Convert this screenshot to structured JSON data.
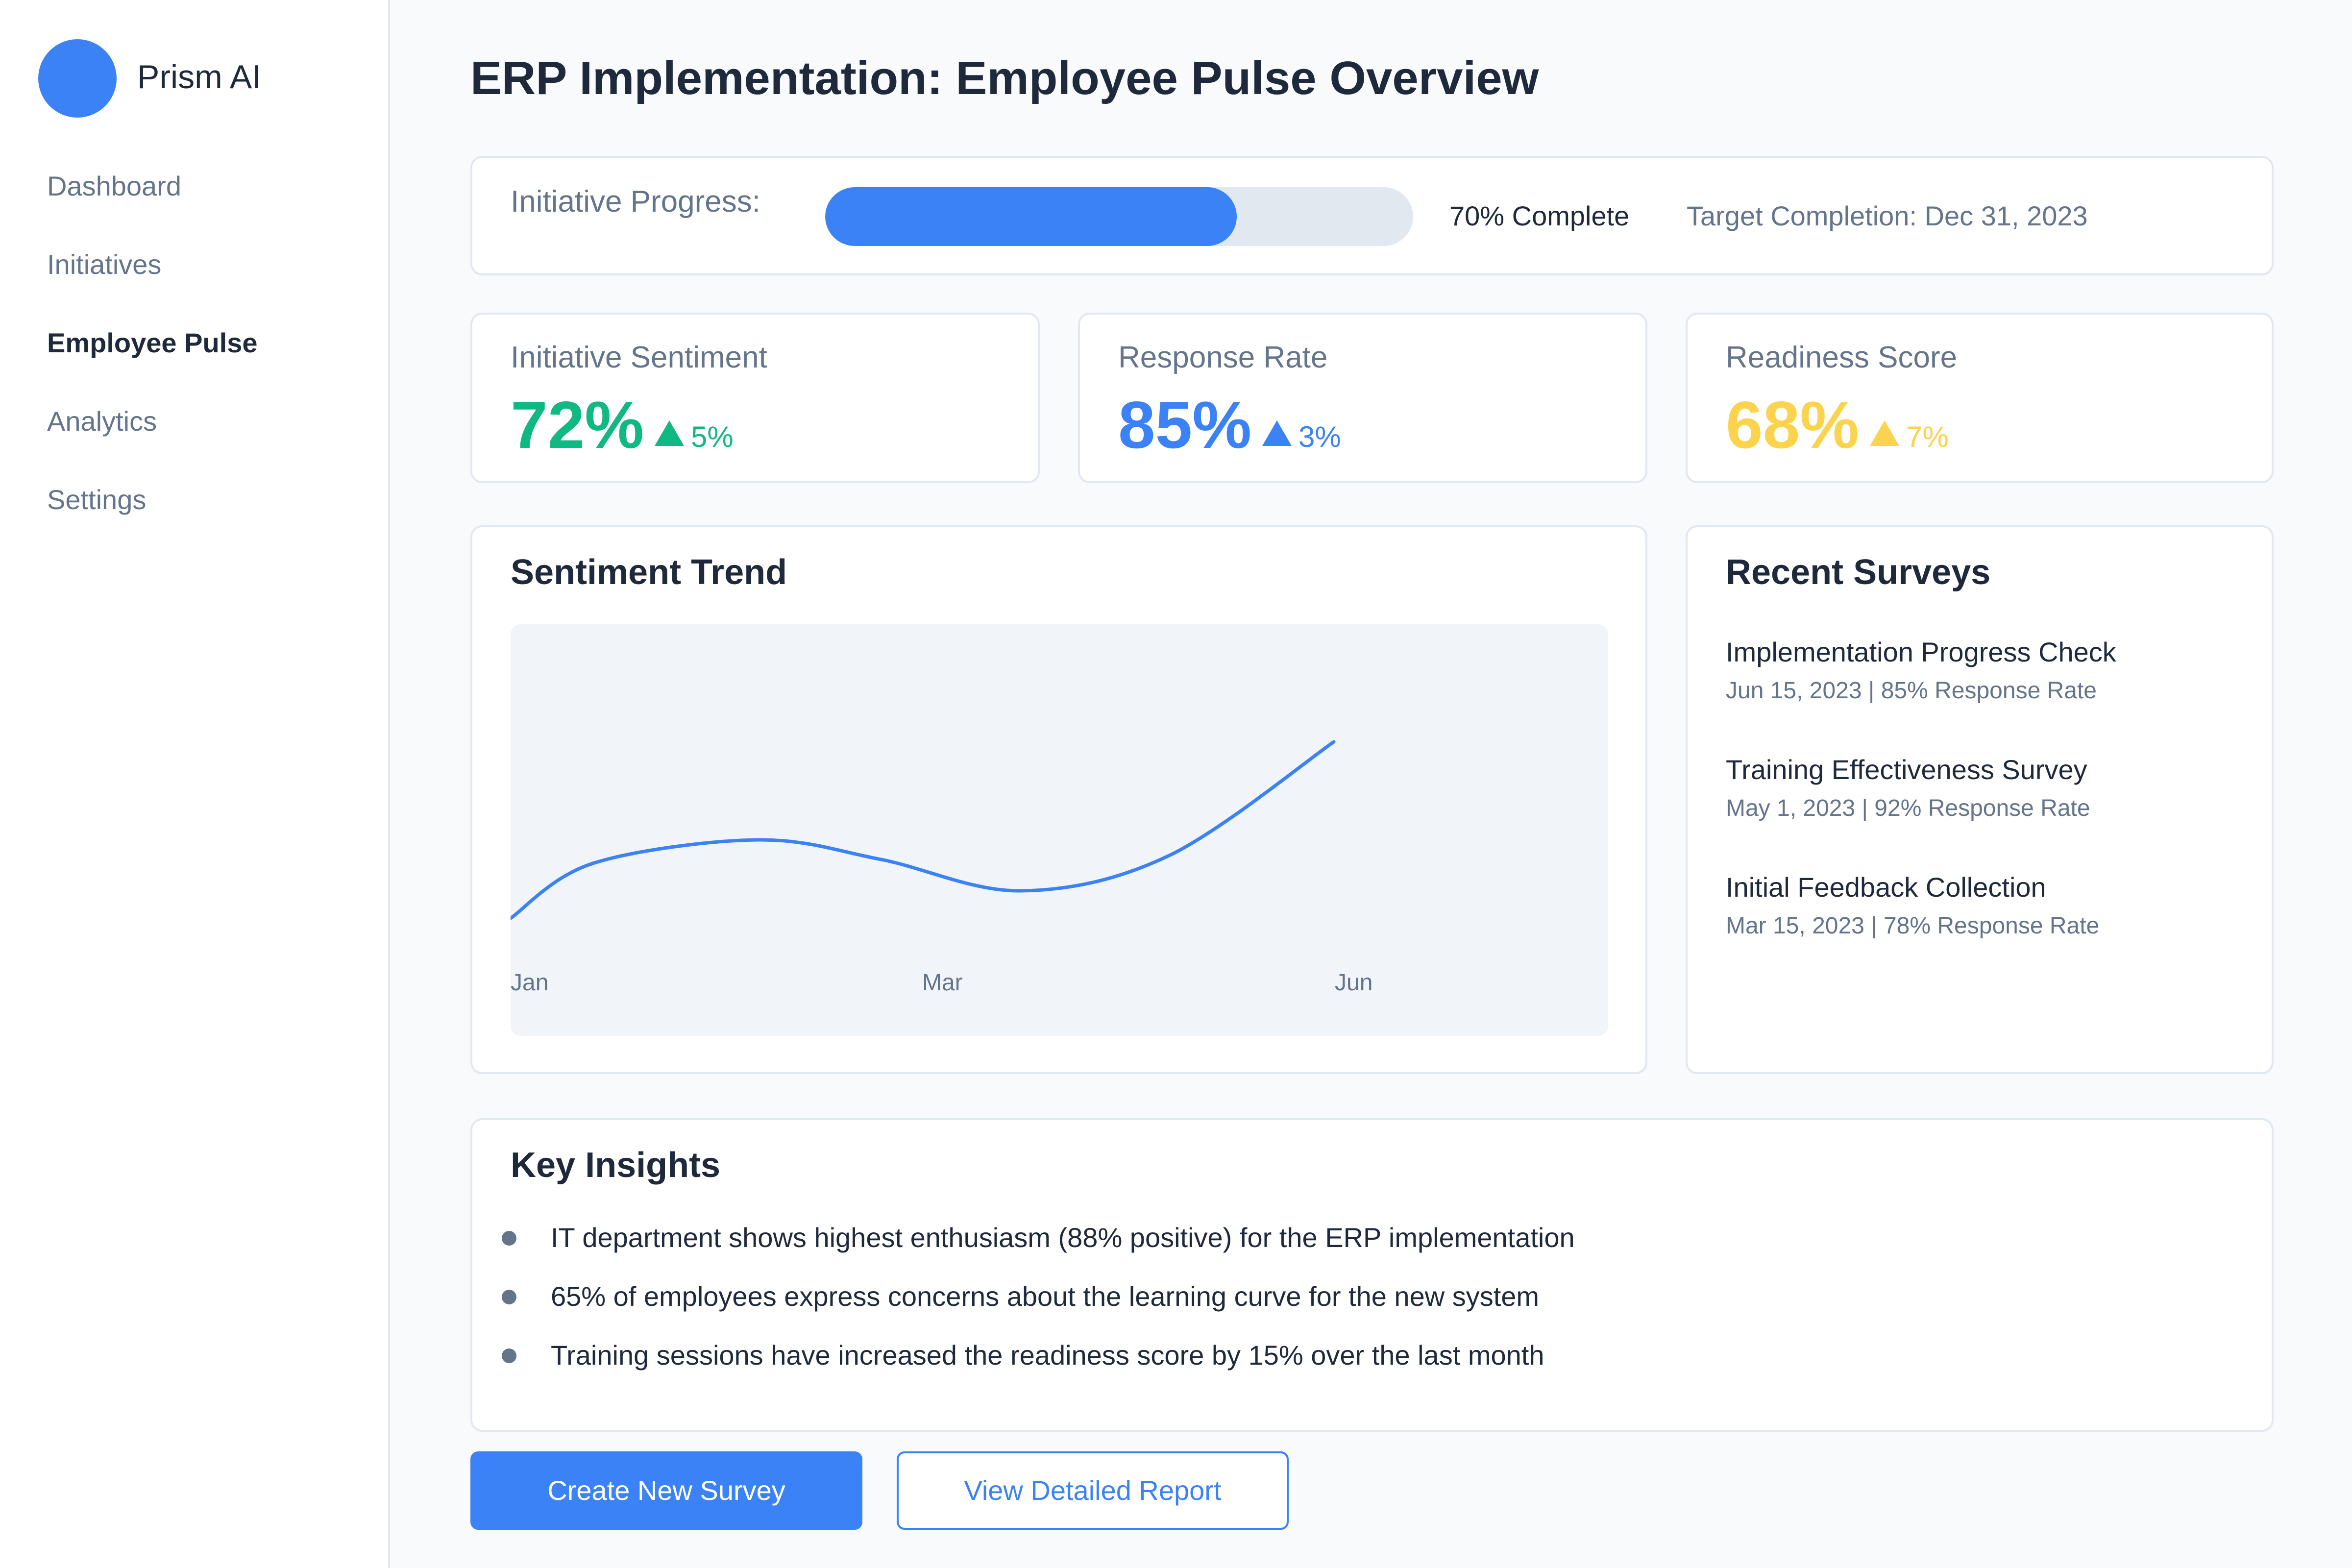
{
  "app": {
    "brand": "Prism AI",
    "accent_color": "#3b82f6"
  },
  "sidebar": {
    "items": [
      {
        "label": "Dashboard",
        "active": false
      },
      {
        "label": "Initiatives",
        "active": false
      },
      {
        "label": "Employee Pulse",
        "active": true
      },
      {
        "label": "Analytics",
        "active": false
      },
      {
        "label": "Settings",
        "active": false
      }
    ]
  },
  "page": {
    "title": "ERP Implementation: Employee Pulse Overview"
  },
  "progress": {
    "label": "Initiative Progress:",
    "percent": 70,
    "text": "70% Complete",
    "target": "Target Completion: Dec 31, 2023"
  },
  "metrics": [
    {
      "label": "Initiative Sentiment",
      "value": "72%",
      "delta": "5%",
      "color": "#10b981"
    },
    {
      "label": "Response Rate",
      "value": "85%",
      "delta": "3%",
      "color": "#3b82f6"
    },
    {
      "label": "Readiness Score",
      "value": "68%",
      "delta": "7%",
      "color": "#fcd34d"
    }
  ],
  "sentiment_trend": {
    "title": "Sentiment Trend",
    "icon": "trend-line",
    "line_color": "#3b82f6"
  },
  "chart_data": {
    "type": "line",
    "title": "Sentiment Trend",
    "x_tick_labels": [
      "Jan",
      "Mar",
      "Jun"
    ],
    "series": [
      {
        "values": [
          {
            "x": 0.0,
            "y": 0.1
          },
          {
            "x": 0.1,
            "y": 0.38
          },
          {
            "x": 0.3,
            "y": 0.5
          },
          {
            "x": 0.45,
            "y": 0.4
          },
          {
            "x": 0.62,
            "y": 0.24
          },
          {
            "x": 0.8,
            "y": 0.42
          },
          {
            "x": 1.0,
            "y": 1.0
          }
        ]
      }
    ],
    "x_range": [
      0,
      1
    ],
    "y_range": [
      0,
      1.4
    ],
    "grid": false,
    "legend": "none"
  },
  "recent_surveys": {
    "title": "Recent Surveys",
    "items": [
      {
        "title": "Implementation Progress Check",
        "meta": "Jun 15, 2023 | 85% Response Rate"
      },
      {
        "title": "Training Effectiveness Survey",
        "meta": "May 1, 2023 | 92% Response Rate"
      },
      {
        "title": "Initial Feedback Collection",
        "meta": "Mar 15, 2023 | 78% Response Rate"
      }
    ]
  },
  "insights": {
    "title": "Key Insights",
    "items": [
      "IT department shows highest enthusiasm (88% positive) for the ERP implementation",
      "65% of employees express concerns about the learning curve for the new system",
      "Training sessions have increased the readiness score by 15% over the last month"
    ]
  },
  "actions": {
    "create_label": "Create New Survey",
    "report_label": "View Detailed Report"
  }
}
